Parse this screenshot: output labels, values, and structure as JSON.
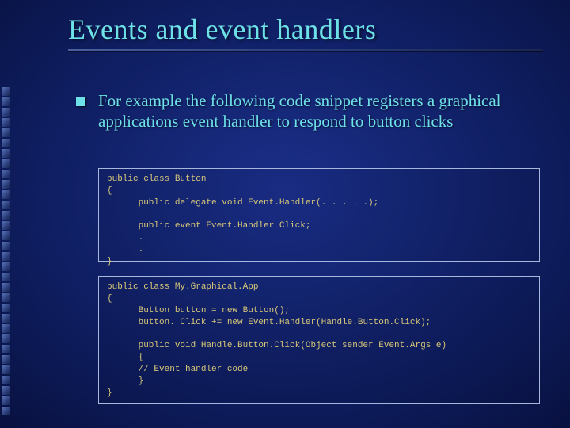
{
  "title": "Events and event handlers",
  "body": "For example the following code snippet registers a graphical applications event handler to respond to button clicks",
  "code1": "public class Button\n{\n      public delegate void Event.Handler(. . . . .);\n\n      public event Event.Handler Click;\n      .\n      .\n}",
  "code2": "public class My.Graphical.App\n{\n      Button button = new Button();\n      button. Click += new Event.Handler(Handle.Button.Click);\n\n      public void Handle.Button.Click(Object sender Event.Args e)\n      {\n      // Event handler code\n      }\n}"
}
